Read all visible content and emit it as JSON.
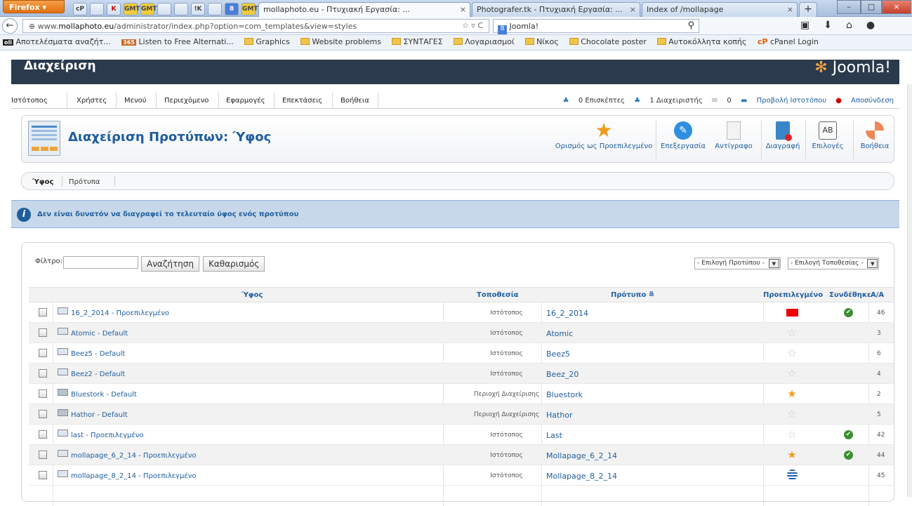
{
  "browser": {
    "menu_label": "Firefox ▾",
    "pinned": [
      "cP",
      "",
      "K",
      "GMT",
      "GMT",
      "",
      "",
      "!K",
      "",
      "8",
      "GMT"
    ],
    "tabs": [
      {
        "label": "mollaphoto.eu - Πτυχιακή Εργασία: ...",
        "active": true
      },
      {
        "label": "Photografer.tk - Πτυχιακή Εργασία: ...",
        "active": false
      },
      {
        "label": "Index of /mollapage",
        "active": false
      }
    ],
    "new_tab": "+",
    "url_prefix": "www.",
    "url_domain": "mollaphoto.eu",
    "url_rest": "/administrator/index.php?option=com_templates&view=styles",
    "search_value": "Joomla!",
    "search_engine_icon": "google-icon"
  },
  "bookmarks": [
    {
      "label": "Αποτελέσματα αναζήτ...",
      "icon": "search-results-icon"
    },
    {
      "label": "Listen to Free Alternati...",
      "icon": "radio-icon"
    },
    {
      "label": "Graphics",
      "icon": "folder-icon"
    },
    {
      "label": "Website problems",
      "icon": "folder-icon"
    },
    {
      "label": "ΣΥΝΤΑΓΕΣ",
      "icon": "folder-icon"
    },
    {
      "label": "Λογαριασμοί",
      "icon": "folder-icon"
    },
    {
      "label": "Νίκος",
      "icon": "folder-icon"
    },
    {
      "label": "Chocolate poster",
      "icon": "folder-icon"
    },
    {
      "label": "Αυτοκόλλητα κοπής",
      "icon": "folder-icon"
    },
    {
      "label": "cPanel Login",
      "icon": "cpanel-icon"
    }
  ],
  "header": {
    "title": "Διαχείριση",
    "logo_a": "Joo",
    "logo_b": "mla!"
  },
  "menu": {
    "items": [
      "Ιστότοπος",
      "Χρήστες",
      "Μενού",
      "Περιεχόμενο",
      "Εφαρμογές",
      "Επεκτάσεις",
      "Βοήθεια"
    ],
    "visitors": "0 Επισκέπτες",
    "admins": "1 Διαχειριστής",
    "messages": "0",
    "view_site": "Προβολή Ιστοτόπου",
    "logout": "Αποσύνδεση"
  },
  "toolbar": {
    "title": "Διαχείριση Προτύπων: Ύφος",
    "buttons": [
      {
        "label": "Ορισμός ως Προεπιλεγμένο",
        "icon": "star-icon"
      },
      {
        "label": "Επεξεργασία",
        "icon": "pencil-icon"
      },
      {
        "label": "Αντίγραφο",
        "icon": "copy-icon"
      },
      {
        "label": "Διαγραφή",
        "icon": "trash-icon"
      },
      {
        "label": "Επιλογές",
        "icon": "options-icon"
      },
      {
        "label": "Βοήθεια",
        "icon": "help-icon"
      }
    ]
  },
  "submenu": {
    "active": "Ύφος",
    "other": "Πρότυπα"
  },
  "message": {
    "text": "Δεν είναι δυνατόν να διαγραφεί το τελευταίο ύφος ενός προτύπου"
  },
  "filter": {
    "label": "Φίλτρο:",
    "value": "",
    "search": "Αναζήτηση",
    "clear": "Καθαρισμός",
    "select_template": "- Επιλογή Προτύπου -",
    "select_location": "- Επιλογή Τοποθεσίας -"
  },
  "table": {
    "headers": {
      "style": "Ύφος",
      "location": "Τοποθεσία",
      "template": "Πρότυπο",
      "default": "Προεπιλεγμένο",
      "assigned": "Συνδέθηκε",
      "id": "Α/Α"
    },
    "rows": [
      {
        "name": "16_2_2014 - Προεπιλεγμένο",
        "location": "Ιστότοπος",
        "template": "16_2_2014",
        "default": "flag-china",
        "assigned": true,
        "id": "46",
        "admin": false
      },
      {
        "name": "Atomic - Default",
        "location": "Ιστότοπος",
        "template": "Atomic",
        "default": "star-off",
        "assigned": false,
        "id": "3",
        "admin": false
      },
      {
        "name": "Beez5 - Default",
        "location": "Ιστότοπος",
        "template": "Beez5",
        "default": "star-off",
        "assigned": false,
        "id": "6",
        "admin": false
      },
      {
        "name": "Beez2 - Default",
        "location": "Ιστότοπος",
        "template": "Beez_20",
        "default": "star-off",
        "assigned": false,
        "id": "4",
        "admin": false
      },
      {
        "name": "Bluestork - Default",
        "location": "Περιοχή Διαχείρισης",
        "template": "Bluestork",
        "default": "star-on",
        "assigned": false,
        "id": "2",
        "admin": true
      },
      {
        "name": "Hathor - Default",
        "location": "Περιοχή Διαχείρισης",
        "template": "Hathor",
        "default": "star-off",
        "assigned": false,
        "id": "5",
        "admin": true
      },
      {
        "name": "last - Προεπιλεγμένο",
        "location": "Ιστότοπος",
        "template": "Last",
        "default": "star-off",
        "assigned": true,
        "id": "42",
        "admin": false
      },
      {
        "name": "mollapage_6_2_14 - Προεπιλεγμένο",
        "location": "Ιστότοπος",
        "template": "Mollapage_6_2_14",
        "default": "star-on",
        "assigned": true,
        "id": "44",
        "admin": false
      },
      {
        "name": "mollapage_8_2_14 - Προεπιλεγμένο",
        "location": "Ιστότοπος",
        "template": "Mollapage_8_2_14",
        "default": "flag-greece",
        "assigned": false,
        "id": "45",
        "admin": false
      }
    ]
  },
  "colors": {
    "link": "#1f5d9c",
    "header_bg": "#2b3a4d",
    "message_bg": "#c6d8ea",
    "star_on": "#f29a1b"
  }
}
